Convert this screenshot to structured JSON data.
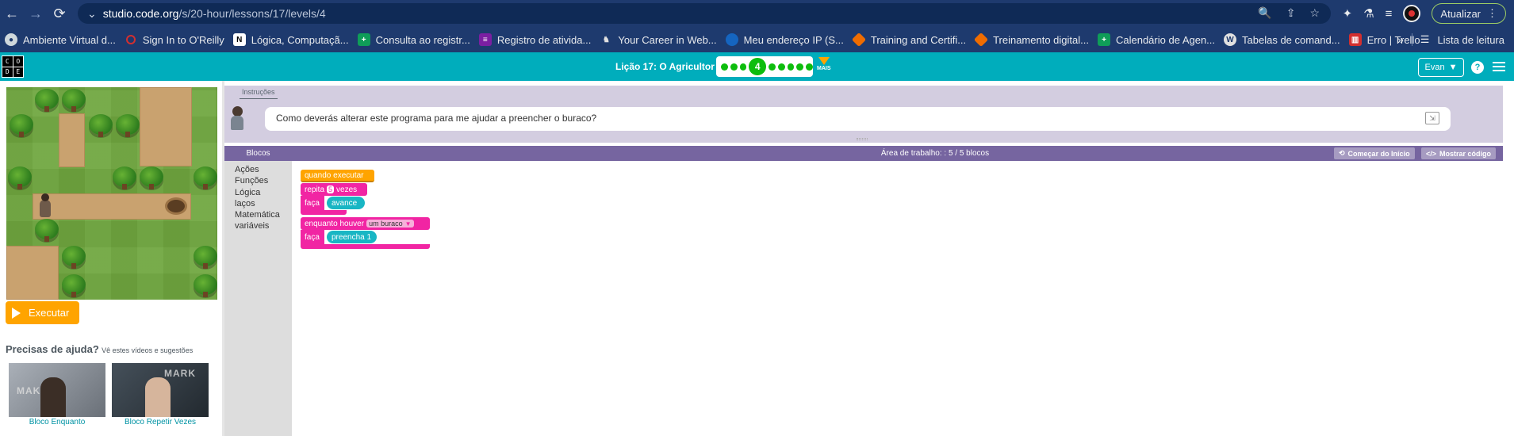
{
  "browser": {
    "url_host": "studio.code.org",
    "url_path": "/s/20-hour/lessons/17/levels/4",
    "update_label": "Atualizar"
  },
  "bookmarks": [
    {
      "label": "Ambiente Virtual d...",
      "icon": "globe-icon",
      "color": "#cfd8dc"
    },
    {
      "label": "Sign In to O'Reilly",
      "icon": "oreilly-icon",
      "color": "#d32f2f"
    },
    {
      "label": "Lógica, Computaçã...",
      "icon": "notion-icon",
      "color": "#ffffff"
    },
    {
      "label": "Consulta ao registr...",
      "icon": "plus-icon",
      "color": "#0f9d58"
    },
    {
      "label": "Registro de ativida...",
      "icon": "list-icon",
      "color": "#7b1fa2"
    },
    {
      "label": "Your Career in Web...",
      "icon": "viking-icon",
      "color": "#9e9e9e"
    },
    {
      "label": "Meu endereço IP (S...",
      "icon": "ip-icon",
      "color": "#1565c0"
    },
    {
      "label": "Training and Certifi...",
      "icon": "cube-icon",
      "color": "#ef6c00"
    },
    {
      "label": "Treinamento digital...",
      "icon": "cube-icon",
      "color": "#ef6c00"
    },
    {
      "label": "Calendário de Agen...",
      "icon": "plus-icon",
      "color": "#0f9d58"
    },
    {
      "label": "Tabelas de comand...",
      "icon": "wordpress-icon",
      "color": "#e0e0e0"
    },
    {
      "label": "Erro | Trello",
      "icon": "trello-icon",
      "color": "#d32f2f"
    }
  ],
  "reading_list": "Lista de leitura",
  "header": {
    "lesson_title": "Lição 17: O Agricultor 3",
    "current_level": "4",
    "more_label": "MAIS",
    "user_name": "Evan",
    "logo_letters": [
      "C",
      "O",
      "D",
      "E"
    ]
  },
  "left": {
    "run_label": "Executar",
    "help_title": "Precisas de ajuda?",
    "help_subtitle": "Vê estes vídeos e sugestões",
    "videos": [
      {
        "caption": "Bloco Enquanto",
        "overlay": "MAKINDE"
      },
      {
        "caption": "Bloco Repetir Vezes",
        "overlay": "MARK"
      }
    ]
  },
  "instructions": {
    "tab_label": "Instruções",
    "text": "Como deverás alterar este programa para me ajudar a preencher o buraco?"
  },
  "workspace": {
    "toolbox_title": "Blocos",
    "title": "Área de trabalho: : 5 / 5 blocos",
    "start_over_label": "Começar do Início",
    "show_code_label": "Mostrar código",
    "categories": [
      "Ações",
      "Funções",
      "Lógica",
      "laços",
      "Matemática",
      "variáveis"
    ],
    "blocks": {
      "when_run": "quando executar",
      "repeat_prefix": "repita",
      "repeat_count": "5",
      "repeat_suffix": "vezes",
      "do_label": "faça",
      "move": "avance",
      "while_prefix": "enquanto houver",
      "while_condition": "um buraco",
      "do_label2": "faça",
      "fill": "preencha 1"
    }
  }
}
